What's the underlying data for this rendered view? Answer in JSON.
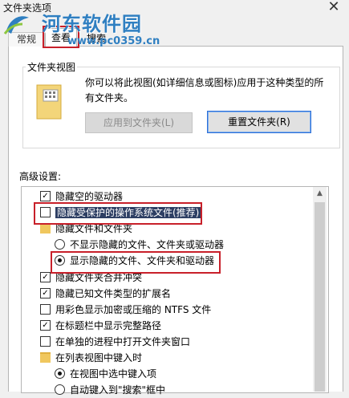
{
  "window": {
    "title": "文件夹选项",
    "close_glyph": "✕"
  },
  "watermark": {
    "name": "河东软件园",
    "url": "www.pc0359.cn"
  },
  "tabs": [
    {
      "label": "常规",
      "active": false
    },
    {
      "label": "查看",
      "active": true
    },
    {
      "label": "搜索",
      "active": false
    }
  ],
  "folder_views": {
    "group_label": "文件夹视图",
    "description": "你可以将此视图(如详细信息或图标)应用于这种类型的所有文件夹。",
    "apply_label": "应用到文件夹(L)",
    "reset_label": "重置文件夹(R)"
  },
  "advanced": {
    "label": "高级设置:",
    "items": [
      {
        "kind": "checkbox",
        "checked": true,
        "label": "隐藏空的驱动器"
      },
      {
        "kind": "checkbox",
        "checked": false,
        "label": "隐藏受保护的操作系统文件(推荐)"
      },
      {
        "kind": "folder",
        "label": "隐藏文件和文件夹"
      },
      {
        "kind": "radio",
        "checked": false,
        "label": "不显示隐藏的文件、文件夹或驱动器"
      },
      {
        "kind": "radio",
        "checked": true,
        "label": "显示隐藏的文件、文件夹和驱动器"
      },
      {
        "kind": "checkbox",
        "checked": true,
        "label": "隐藏文件夹合并冲突"
      },
      {
        "kind": "checkbox",
        "checked": true,
        "label": "隐藏已知文件类型的扩展名"
      },
      {
        "kind": "checkbox",
        "checked": false,
        "label": "用彩色显示加密或压缩的 NTFS 文件"
      },
      {
        "kind": "checkbox",
        "checked": true,
        "label": "在标题栏中显示完整路径"
      },
      {
        "kind": "checkbox",
        "checked": false,
        "label": "在单独的进程中打开文件夹窗口"
      },
      {
        "kind": "folder",
        "label": "在列表视图中键入时"
      },
      {
        "kind": "radio",
        "checked": true,
        "label": "在视图中选中键入项"
      },
      {
        "kind": "radio",
        "checked": false,
        "label": "自动键入到\"搜索\"框中"
      }
    ]
  },
  "icons": {
    "scroll_up": "▲",
    "check": "✓"
  },
  "colors": {
    "highlight_red": "#c8202a",
    "selection_dark": "#2d3e63",
    "watermark_blue": "#2f7fc1"
  }
}
